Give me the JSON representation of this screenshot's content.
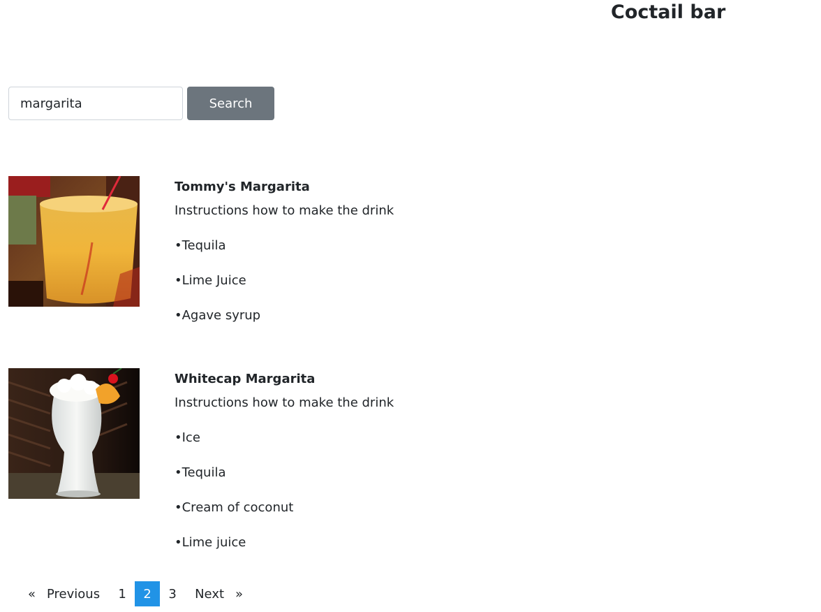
{
  "header": {
    "title": "Coctail bar"
  },
  "search": {
    "value": "margarita",
    "button_label": "Search"
  },
  "drinks": [
    {
      "name": "Tommy's Margarita",
      "instructions": "Instructions how to make the drink",
      "ingredients": [
        "•Tequila",
        "•Lime Juice",
        "•Agave syrup"
      ]
    },
    {
      "name": "Whitecap Margarita",
      "instructions": "Instructions how to make the drink",
      "ingredients": [
        "•Ice",
        "•Tequila",
        "•Cream of coconut",
        "•Lime juice"
      ]
    }
  ],
  "pagination": {
    "prev_arrow": "«",
    "prev_label": "Previous",
    "pages": [
      "1",
      "2",
      "3"
    ],
    "active_page": "2",
    "next_label": "Next",
    "next_arrow": "»",
    "active_color": "#2193e6"
  },
  "colors": {
    "search_button": "#6c757d",
    "text": "#212529"
  }
}
